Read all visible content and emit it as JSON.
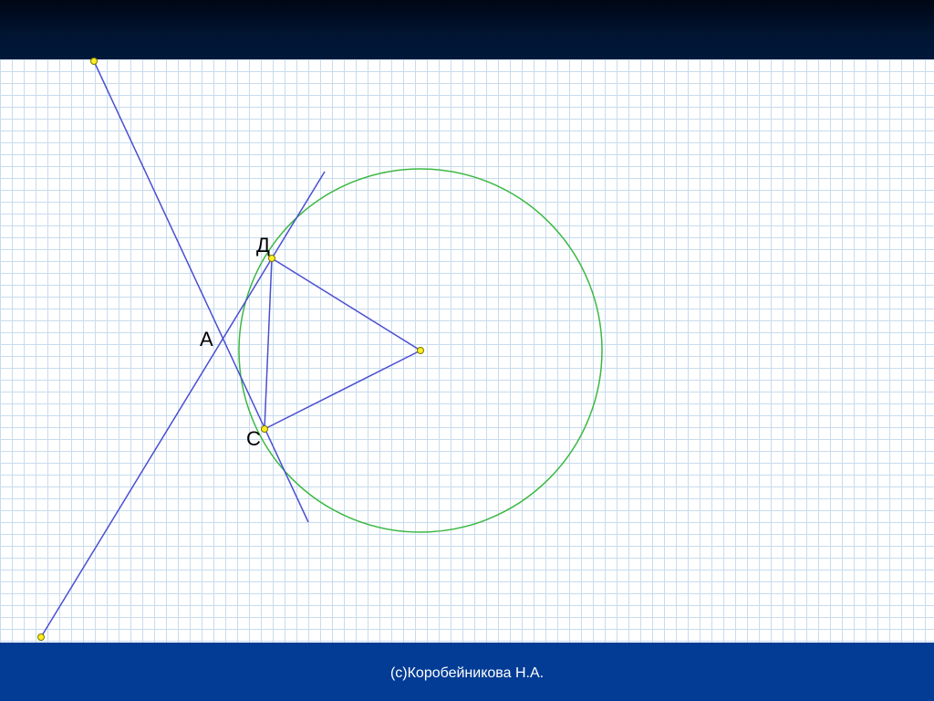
{
  "header": {
    "color": "#01183a"
  },
  "footer": {
    "copyright": "(c)Коробейникова Н.А.",
    "note": "",
    "color": "#033c95"
  },
  "diagram": {
    "points": [
      {
        "id": "D",
        "label": "Д"
      },
      {
        "id": "A",
        "label": "А"
      },
      {
        "id": "C",
        "label": "С"
      }
    ],
    "colors": {
      "circle": "#3cb843",
      "lines": "#4a4fd0",
      "point_fill": "#ffee22",
      "point_stroke": "#777700"
    }
  }
}
